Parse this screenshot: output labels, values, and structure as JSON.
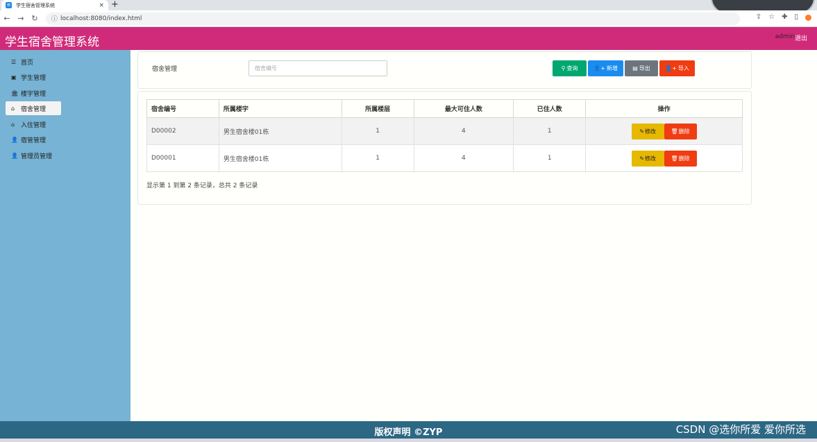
{
  "browser": {
    "tab_title": "学生宿舍管理系统",
    "tab_close": "×",
    "new_tab": "+",
    "url": "localhost:8080/index.html"
  },
  "header": {
    "app_title": "学生宿舍管理系统",
    "admin_user": "admin",
    "logout": "退出"
  },
  "sidebar": {
    "items": [
      {
        "icon": "list-icon",
        "glyph": "☰",
        "label": "首页"
      },
      {
        "icon": "id-card-icon",
        "glyph": "▣",
        "label": "学生管理"
      },
      {
        "icon": "bank-icon",
        "glyph": "🏛",
        "label": "楼宇管理"
      },
      {
        "icon": "home-icon",
        "glyph": "⌂",
        "label": "宿舍管理",
        "active": true
      },
      {
        "icon": "home-icon",
        "glyph": "⌂",
        "label": "入住管理"
      },
      {
        "icon": "user-icon",
        "glyph": "👤",
        "label": "宿管管理"
      },
      {
        "icon": "user-icon",
        "glyph": "👤",
        "label": "管理员管理"
      }
    ]
  },
  "search": {
    "label": "宿舍管理",
    "placeholder": "宿舍编号",
    "query_label": "查询",
    "add_label": "新增",
    "export_label": "导出",
    "import_label": "导入"
  },
  "table": {
    "columns": [
      "宿舍编号",
      "所属楼宇",
      "所属楼层",
      "最大可住人数",
      "已住人数",
      "操作"
    ],
    "rows": [
      {
        "code": "D00002",
        "building": "男生宿舍楼01栋",
        "floor": "1",
        "max": "4",
        "current": "1"
      },
      {
        "code": "D00001",
        "building": "男生宿舍楼01栋",
        "floor": "1",
        "max": "4",
        "current": "1"
      }
    ],
    "edit_label": "修改",
    "delete_label": "删除",
    "pager_text": "显示第 1 到第 2 条记录，总共 2 条记录"
  },
  "footer": {
    "copyright": "版权声明 ©ZYP",
    "watermark": "CSDN @选你所爱 爱你所选"
  },
  "colors": {
    "header": "#d02b7a",
    "sidebar": "#76b3d4",
    "footer": "#2c6784",
    "query": "#00a870",
    "add": "#1a8cf0",
    "export": "#6c757d",
    "import": "#f03c12",
    "edit": "#e6b800",
    "delete": "#f03c12"
  }
}
